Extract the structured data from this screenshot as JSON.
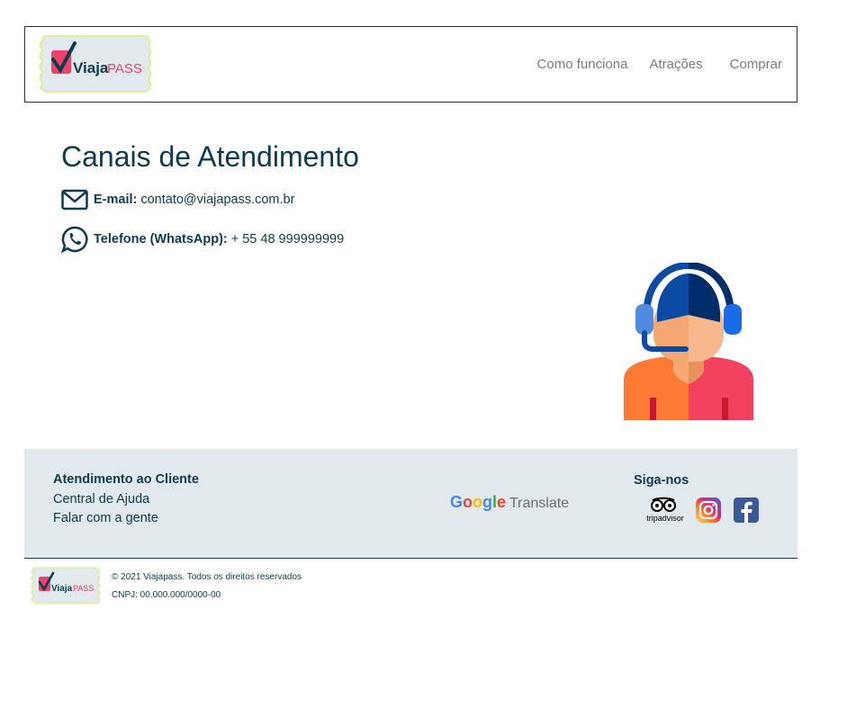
{
  "header": {
    "logo_text_a": "Viaja",
    "logo_text_b": "PASS",
    "nav": [
      "Como funciona",
      "Atrações",
      "Comprar"
    ]
  },
  "main": {
    "title": "Canais de Atendimento",
    "email_label": "E-mail:",
    "email_value": "contato@viajapass.com.br",
    "phone_label": "Telefone (WhatsApp):",
    "phone_value": "+ 55 48 999999999"
  },
  "footer": {
    "support_heading": "Atendimento ao Cliente",
    "links": [
      "Central de Ajuda",
      "Falar com a gente"
    ],
    "translate_google": "Google",
    "translate_word": "Translate",
    "follow_heading": "Siga-nos",
    "tripadvisor_text": "tripadvisor",
    "copyright": "© 2021 Viajapass. Todos os direitos reservados",
    "cnpj": "CNPJ: 00.000.000/0000-00"
  },
  "colors": {
    "primary": "#0d3b50",
    "footer_bg": "#e2e9ec",
    "logo_pink": "#f0416b",
    "nav_gray": "#7a7a7a"
  },
  "icons": [
    "logo-ticket",
    "envelope-icon",
    "whatsapp-icon",
    "support-agent-illustration",
    "google-translate-logo",
    "tripadvisor-icon",
    "instagram-icon",
    "facebook-icon"
  ]
}
